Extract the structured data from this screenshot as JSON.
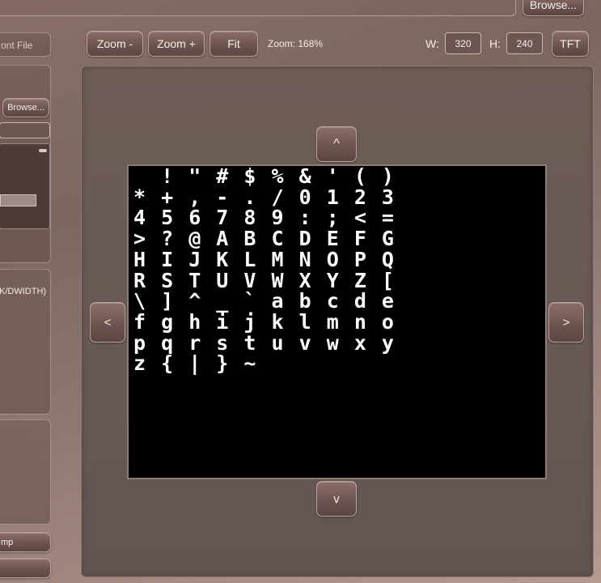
{
  "top": {
    "browse_label": "Browse..."
  },
  "toolbar": {
    "zoom_out_label": "Zoom -",
    "zoom_in_label": "Zoom +",
    "fit_label": "Fit",
    "zoom_text": "Zoom: 168%",
    "width_label": "W:",
    "width_value": "320",
    "height_label": "H:",
    "height_value": "240",
    "tft_label": "TFT"
  },
  "sidebar": {
    "tab_label": "ont File",
    "browse_label": "Browse...",
    "info_text": "K/DWIDTH)",
    "bottom_button_label": "mp"
  },
  "preview": {
    "up_label": "^",
    "down_label": "v",
    "left_label": "<",
    "right_label": ">",
    "glyph_rows": [
      "  ! \" # $ % & ' ( )",
      "* + , - . / 0 1 2 3",
      "4 5 6 7 8 9 : ; < =",
      "> ? @ A B C D E F G",
      "H I J K L M N O P Q",
      "R S T U V W X Y Z [",
      "\\ ] ^ _ ` a b c d e",
      "f g h i j k l m n o",
      "p q r s t u v w x y",
      "z { | } ~"
    ]
  },
  "colors": {
    "screen_background": "#000000",
    "glyph_color": "#ffffff",
    "accent": "#6e5450"
  }
}
